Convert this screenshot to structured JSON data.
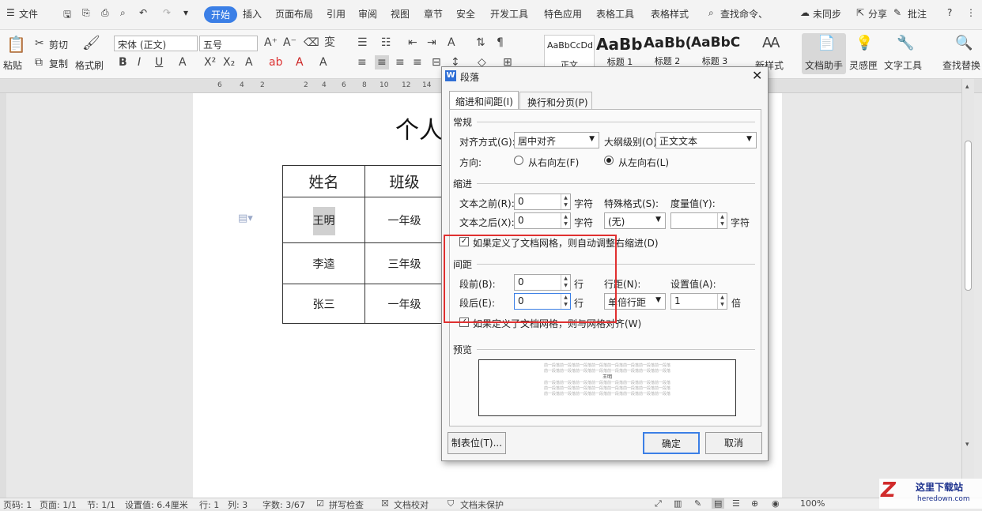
{
  "menu": {
    "file": "文件",
    "tabs": [
      "开始",
      "插入",
      "页面布局",
      "引用",
      "审阅",
      "视图",
      "章节",
      "安全",
      "开发工具",
      "特色应用",
      "表格工具",
      "表格样式"
    ],
    "search": "查找命令、",
    "sync": "未同步",
    "share": "分享",
    "comment": "批注"
  },
  "ribbon": {
    "paste": "粘贴",
    "cut": "剪切",
    "copy": "复制",
    "format_painter": "格式刷",
    "font": "宋体 (正文)",
    "size": "五号",
    "styles": [
      {
        "preview": "AaBbCcDd",
        "name": "正文"
      },
      {
        "preview": "AaBb",
        "name": "标题 1"
      },
      {
        "preview": "AaBb(",
        "name": "标题 2"
      },
      {
        "preview": "AaBbC",
        "name": "标题 3"
      }
    ],
    "new_style": "新样式",
    "doc_assistant": "文档助手",
    "inspiration": "灵感匣",
    "text_tools": "文字工具",
    "find_replace": "查找替换"
  },
  "ruler": [
    "6",
    "4",
    "2",
    "2",
    "4",
    "6",
    "8",
    "10",
    "12",
    "14"
  ],
  "doc": {
    "title": "个人",
    "headers": [
      "姓名",
      "班级"
    ],
    "rows": [
      [
        "王明",
        "一年级"
      ],
      [
        "李逵",
        "三年级"
      ],
      [
        "张三",
        "一年级"
      ]
    ]
  },
  "dialog": {
    "title": "段落",
    "tabs": [
      "缩进和间距(I)",
      "换行和分页(P)"
    ],
    "general": "常规",
    "align_label": "对齐方式(G):",
    "align_value": "居中对齐",
    "outline_label": "大纲级别(O):",
    "outline_value": "正文文本",
    "direction_label": "方向:",
    "rtl": "从右向左(F)",
    "ltr": "从左向右(L)",
    "indent": "缩进",
    "before_text": "文本之前(R):",
    "before_val": "0",
    "after_text": "文本之后(X):",
    "after_val": "0",
    "unit_char": "字符",
    "special_label": "特殊格式(S):",
    "special_val": "(无)",
    "measure_label": "度量值(Y):",
    "measure_val": "",
    "auto_adjust": "如果定义了文档网格，则自动调整右缩进(D)",
    "spacing": "间距",
    "before_para": "段前(B):",
    "before_para_val": "0",
    "after_para": "段后(E):",
    "after_para_val": "0",
    "unit_line": "行",
    "line_spacing_label": "行距(N):",
    "line_spacing_val": "单倍行距",
    "setting_label": "设置值(A):",
    "setting_val": "1",
    "unit_times": "倍",
    "snap_grid": "如果定义了文档网格，则与网格对齐(W)",
    "preview": "预览",
    "preview_text": "前一段落前一段落前一段落前一段落前一段落前一段落前一段落前一段落",
    "preview_main": "王明",
    "tabs_button": "制表位(T)...",
    "ok": "确定",
    "cancel": "取消"
  },
  "status": {
    "page": "页码: 1",
    "pages": "页面: 1/1",
    "section": "节: 1/1",
    "setting": "设置值: 6.4厘米",
    "row": "行: 1",
    "col": "列: 3",
    "words": "字数: 3/67",
    "spell": "拼写检查",
    "proof": "文档校对",
    "unprotected": "文档未保护",
    "zoom": "100%"
  },
  "watermark": {
    "name": "这里下载站",
    "url": "heredown.com"
  },
  "colors": {
    "accent": "#3b7fe6",
    "highlight": "#e03030"
  }
}
